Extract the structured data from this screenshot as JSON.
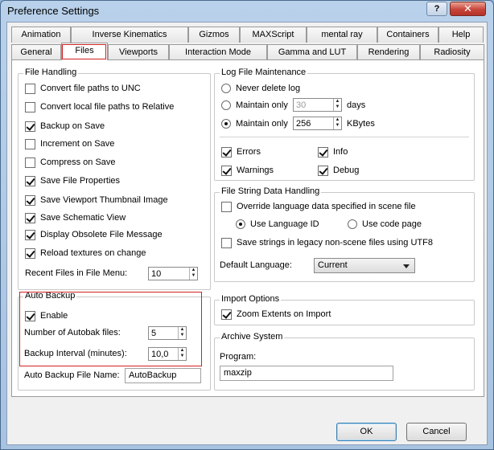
{
  "window": {
    "title": "Preference Settings",
    "help_label": "?",
    "close_label": "✕"
  },
  "tabs": {
    "row1": [
      "Animation",
      "Inverse Kinematics",
      "Gizmos",
      "MAXScript",
      "mental ray",
      "Containers",
      "Help"
    ],
    "row2": [
      "General",
      "Files",
      "Viewports",
      "Interaction Mode",
      "Gamma and LUT",
      "Rendering",
      "Radiosity"
    ],
    "active": "Files"
  },
  "file_handling": {
    "title": "File Handling",
    "options": [
      {
        "label": "Convert file paths to UNC",
        "checked": false
      },
      {
        "label": "Convert local file paths to Relative",
        "checked": false
      },
      {
        "label": "Backup on Save",
        "checked": true
      },
      {
        "label": "Increment on Save",
        "checked": false
      },
      {
        "label": "Compress on Save",
        "checked": false
      },
      {
        "label": "Save File Properties",
        "checked": true
      },
      {
        "label": "Save Viewport Thumbnail Image",
        "checked": true
      },
      {
        "label": "Save Schematic View",
        "checked": true
      },
      {
        "label": "Display Obsolete File Message",
        "checked": true
      },
      {
        "label": "Reload textures on change",
        "checked": true
      }
    ],
    "recent_files_label": "Recent Files in File Menu:",
    "recent_files_value": "10"
  },
  "auto_backup": {
    "title": "Auto Backup",
    "enable_label": "Enable",
    "enable_checked": true,
    "num_files_label": "Number of Autobak files:",
    "num_files_value": "5",
    "interval_label": "Backup Interval (minutes):",
    "interval_value": "10,0",
    "file_name_label": "Auto Backup File Name:",
    "file_name_value": "AutoBackup"
  },
  "log_file": {
    "title": "Log File Maintenance",
    "never_delete_label": "Never delete log",
    "maintain_days_label": "Maintain only",
    "maintain_days_value": "30",
    "days_unit": "days",
    "maintain_kb_label": "Maintain only",
    "maintain_kb_value": "256",
    "kb_unit": "KBytes",
    "selected": "kbytes",
    "errors_label": "Errors",
    "info_label": "Info",
    "warnings_label": "Warnings",
    "debug_label": "Debug"
  },
  "file_string": {
    "title": "File String Data Handling",
    "override_label": "Override language data specified in scene file",
    "use_language_id_label": "Use Language ID",
    "use_code_page_label": "Use code page",
    "save_strings_label": "Save strings in legacy non-scene files using UTF8",
    "default_language_label": "Default Language:",
    "default_language_value": "Current"
  },
  "import_options": {
    "title": "Import Options",
    "zoom_extents_label": "Zoom Extents on Import"
  },
  "archive_system": {
    "title": "Archive System",
    "program_label": "Program:",
    "program_value": "maxzip"
  },
  "buttons": {
    "ok_label": "OK",
    "cancel_label": "Cancel"
  }
}
